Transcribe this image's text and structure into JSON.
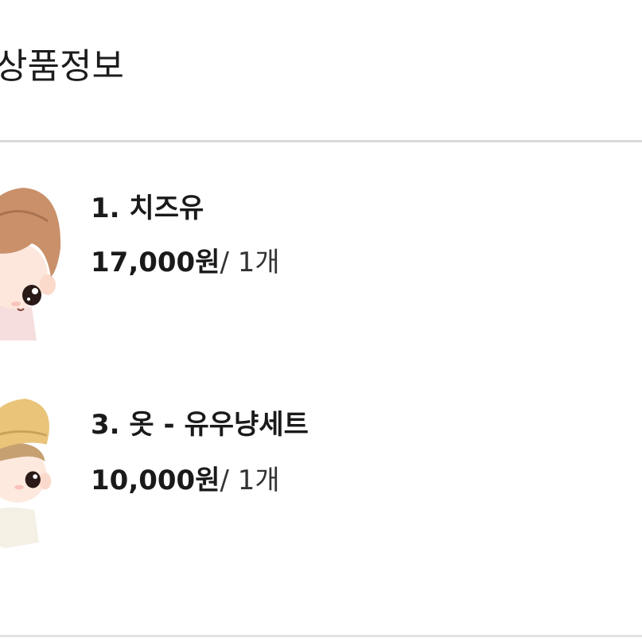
{
  "section": {
    "title": "상품정보"
  },
  "products": [
    {
      "name": "1. 치즈유",
      "price": "17,000원",
      "quantity": "/ 1개",
      "thumbnail_icon": "brown-hair-doll-illustration"
    },
    {
      "name": "3. 옷 - 유우냥세트",
      "price": "10,000원",
      "quantity": "/ 1개",
      "thumbnail_icon": "yellow-hat-doll-illustration"
    }
  ],
  "colors": {
    "text": "#1a1a1a",
    "divider": "#d9d9d9",
    "background": "#ffffff"
  }
}
